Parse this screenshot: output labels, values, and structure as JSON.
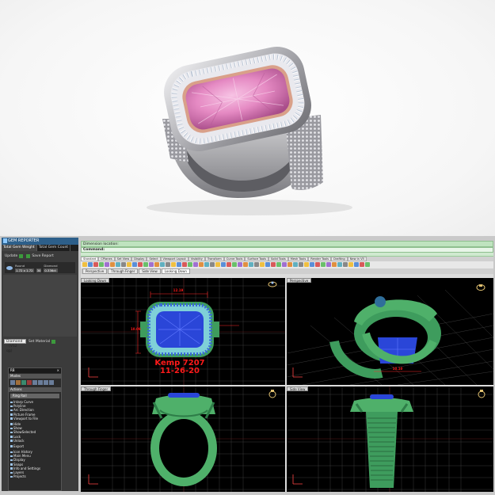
{
  "gem_reporter": {
    "title": "GEM REPORTER",
    "tabs": [
      "Total Gem Weight",
      "Total Gem Count"
    ],
    "buttons": {
      "update": "Update",
      "save_report": "Save Report"
    },
    "columns": [
      {
        "header": "Round",
        "value": "1.72 x 1.72"
      },
      {
        "header": "30",
        "value": ""
      },
      {
        "header": "Diamond",
        "value": "0.336ct"
      }
    ],
    "material": {
      "select_value": "Diamond - (VS2 qg)",
      "set_label": "Set Material"
    }
  },
  "ring_panel": {
    "title": "RB",
    "section_modes": "Modes",
    "section_actions": "Actions",
    "top_item": "Ring Rail",
    "items": [
      "Intarp Curve",
      "Polyline",
      "Arc Direction",
      "Picture Frame",
      "Viewport to File",
      "Hide",
      "Show",
      "ShowSelected",
      "Lock",
      "Unlock",
      "Export",
      "Icon History",
      "Main Menu",
      "Display",
      "Snaps",
      "Info and Settings",
      "Layers",
      "Projects"
    ]
  },
  "app": {
    "status_line": "Dimension location:",
    "command_label": "Command:",
    "toolbar_tabs": [
      "Standard",
      "CPlanes",
      "Set View",
      "Display",
      "Select",
      "Viewport Layout",
      "Visibility",
      "Transform",
      "Curve Tools",
      "Surface Tools",
      "Solid Tools",
      "Mesh Tools",
      "Render Tools",
      "Drafting",
      "New in V5"
    ],
    "viewport_tabs": [
      "Perspective",
      "Through Finger",
      "Side View",
      "Looking Down"
    ],
    "viewports": {
      "top_left": "Looking Down",
      "top_right": "Perspective",
      "bottom_left": "Through Finger",
      "bottom_right": "Side View"
    },
    "annotation": {
      "line1": "Kemp 7207",
      "line2": "11-26-20"
    },
    "dimensions": {
      "width": "12.19",
      "height": "10.09",
      "persp": "10.10"
    }
  },
  "colors": {
    "ring_green": "#4fb06a",
    "stone_blue": "#2a46d8",
    "annotation_red": "#ff1a1a",
    "photo_stone_pink": "#e98fc6",
    "photo_metal": "#c8c8cc",
    "rose_gold": "#d9a089"
  }
}
